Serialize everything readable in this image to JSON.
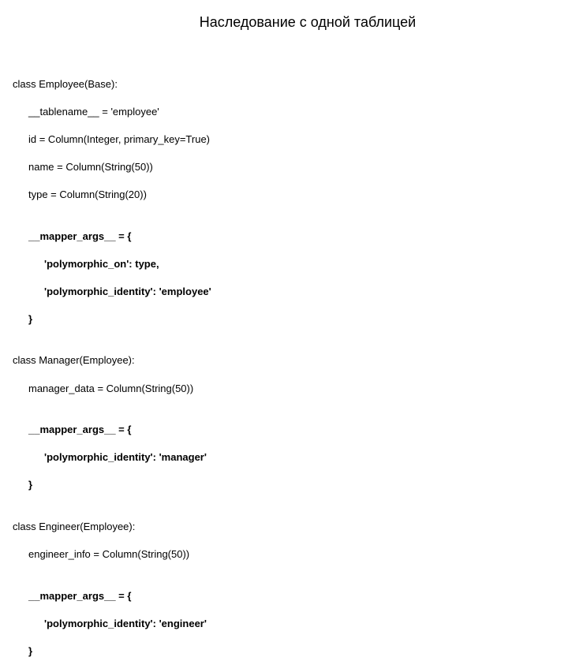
{
  "title": "Наследование с одной таблицей",
  "code": {
    "l1": "class Employee(Base):",
    "l2": "__tablename__ = 'employee'",
    "l3": "id = Column(Integer, primary_key=True)",
    "l4": "name = Column(String(50))",
    "l5": "type = Column(String(20))",
    "blank1": "",
    "l6": "__mapper_args__ = {",
    "l7": "'polymorphic_on': type,",
    "l8": "'polymorphic_identity': 'employee'",
    "l9": "}",
    "blank2": "",
    "l10": "class Manager(Employee):",
    "l11": "manager_data = Column(String(50))",
    "blank3": "",
    "l12": "__mapper_args__ = {",
    "l13": "'polymorphic_identity': 'manager'",
    "l14": "}",
    "blank4": "",
    "l15": "class Engineer(Employee):",
    "l16": "engineer_info = Column(String(50))",
    "blank5": "",
    "l17": "__mapper_args__ = {",
    "l18": "'polymorphic_identity': 'engineer'",
    "l19": "}"
  }
}
